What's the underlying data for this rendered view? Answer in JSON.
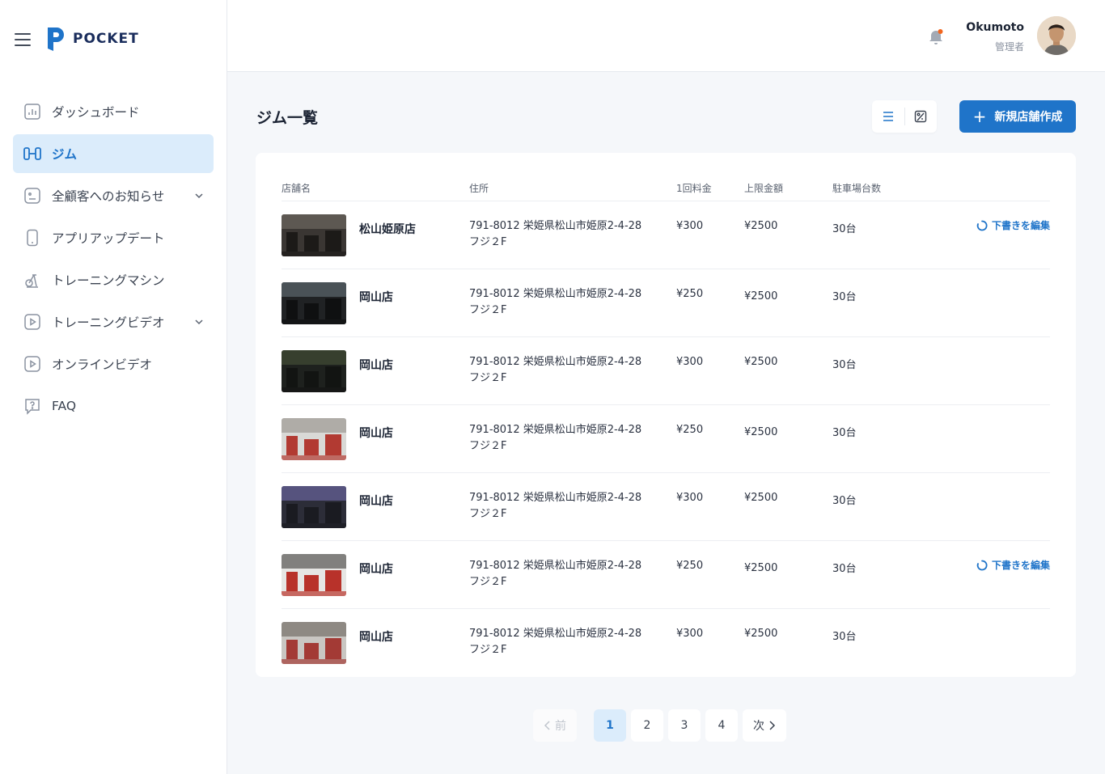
{
  "brand": {
    "name": "POCKET"
  },
  "nav": [
    {
      "label": "ダッシュボード",
      "icon": "chart-icon",
      "active": false
    },
    {
      "label": "ジム",
      "icon": "gym-icon",
      "active": true
    },
    {
      "label": "全顧客へのお知らせ",
      "icon": "announcement-icon",
      "active": false,
      "expandable": true
    },
    {
      "label": "アプリアップデート",
      "icon": "phone-icon",
      "active": false
    },
    {
      "label": "トレーニングマシン",
      "icon": "exercise-bike-icon",
      "active": false
    },
    {
      "label": "トレーニングビデオ",
      "icon": "video-icon",
      "active": false,
      "expandable": true
    },
    {
      "label": "オンラインビデオ",
      "icon": "video-icon",
      "active": false
    },
    {
      "label": "FAQ",
      "icon": "question-icon",
      "active": false
    }
  ],
  "header": {
    "user_name": "Okumoto",
    "user_role": "管理者"
  },
  "page": {
    "title": "ジム一覧",
    "create_label": "新規店舗作成"
  },
  "table": {
    "columns": {
      "name": "店舗名",
      "address": "住所",
      "fee": "1回料金",
      "limit": "上限金額",
      "parking": "駐車場台数"
    },
    "edit_draft_label": "下書きを編集",
    "rows": [
      {
        "name": "松山姫原店",
        "address1": "791-8012 栄姫県松山市姫原2-4-28",
        "address2": "フジ２F",
        "fee": "¥300",
        "limit": "¥2500",
        "parking": "30台",
        "draft": true
      },
      {
        "name": "岡山店",
        "address1": "791-8012 栄姫県松山市姫原2-4-28",
        "address2": "フジ２F",
        "fee": "¥250",
        "limit": "¥2500",
        "parking": "30台",
        "draft": false
      },
      {
        "name": "岡山店",
        "address1": "791-8012 栄姫県松山市姫原2-4-28",
        "address2": "フジ２F",
        "fee": "¥300",
        "limit": "¥2500",
        "parking": "30台",
        "draft": false
      },
      {
        "name": "岡山店",
        "address1": "791-8012 栄姫県松山市姫原2-4-28",
        "address2": "フジ２F",
        "fee": "¥250",
        "limit": "¥2500",
        "parking": "30台",
        "draft": false
      },
      {
        "name": "岡山店",
        "address1": "791-8012 栄姫県松山市姫原2-4-28",
        "address2": "フジ２F",
        "fee": "¥300",
        "limit": "¥2500",
        "parking": "30台",
        "draft": false
      },
      {
        "name": "岡山店",
        "address1": "791-8012 栄姫県松山市姫原2-4-28",
        "address2": "フジ２F",
        "fee": "¥250",
        "limit": "¥2500",
        "parking": "30台",
        "draft": true
      },
      {
        "name": "岡山店",
        "address1": "791-8012 栄姫県松山市姫原2-4-28",
        "address2": "フジ２F",
        "fee": "¥300",
        "limit": "¥2500",
        "parking": "30台",
        "draft": false
      }
    ]
  },
  "pagination": {
    "prev": "前",
    "next": "次",
    "pages": [
      "1",
      "2",
      "3",
      "4"
    ],
    "current": "1"
  },
  "colors": {
    "accent": "#1f74c9",
    "accent_light": "#dbecfb",
    "notification_dot": "#f2661f"
  }
}
